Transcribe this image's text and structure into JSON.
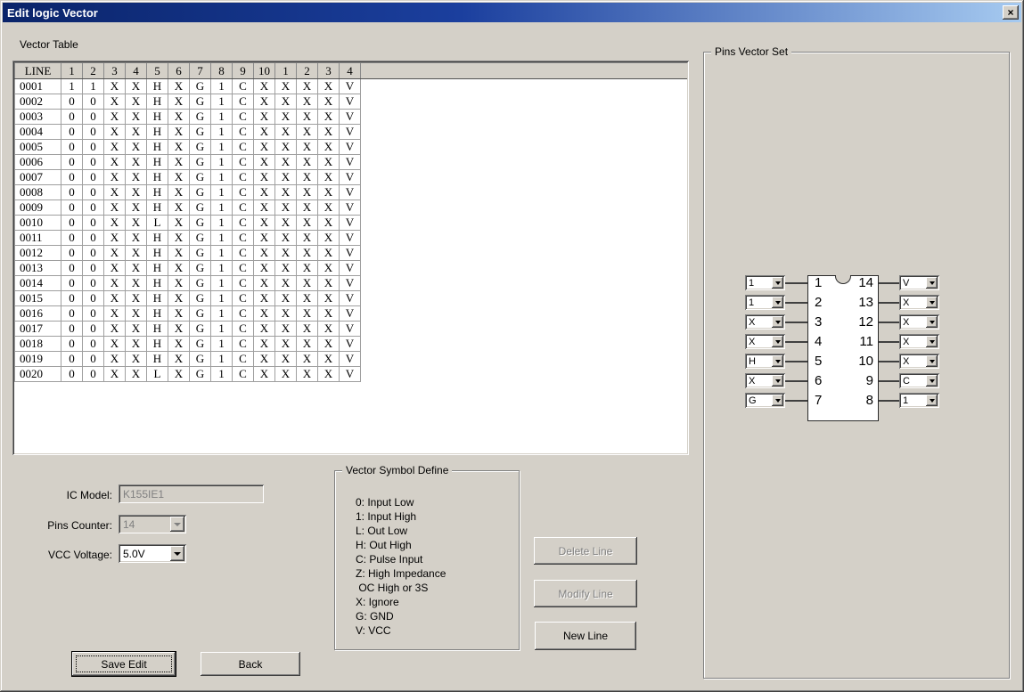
{
  "window": {
    "title": "Edit logic Vector",
    "close_glyph": "×"
  },
  "vector_table": {
    "section_label": "Vector Table",
    "headers": [
      "LINE",
      "1",
      "2",
      "3",
      "4",
      "5",
      "6",
      "7",
      "8",
      "9",
      "10",
      "1",
      "2",
      "3",
      "4"
    ],
    "rows": [
      {
        "line": "0001",
        "values": [
          "1",
          "1",
          "X",
          "X",
          "H",
          "X",
          "G",
          "1",
          "C",
          "X",
          "X",
          "X",
          "X",
          "V"
        ]
      },
      {
        "line": "0002",
        "values": [
          "0",
          "0",
          "X",
          "X",
          "H",
          "X",
          "G",
          "1",
          "C",
          "X",
          "X",
          "X",
          "X",
          "V"
        ]
      },
      {
        "line": "0003",
        "values": [
          "0",
          "0",
          "X",
          "X",
          "H",
          "X",
          "G",
          "1",
          "C",
          "X",
          "X",
          "X",
          "X",
          "V"
        ]
      },
      {
        "line": "0004",
        "values": [
          "0",
          "0",
          "X",
          "X",
          "H",
          "X",
          "G",
          "1",
          "C",
          "X",
          "X",
          "X",
          "X",
          "V"
        ]
      },
      {
        "line": "0005",
        "values": [
          "0",
          "0",
          "X",
          "X",
          "H",
          "X",
          "G",
          "1",
          "C",
          "X",
          "X",
          "X",
          "X",
          "V"
        ]
      },
      {
        "line": "0006",
        "values": [
          "0",
          "0",
          "X",
          "X",
          "H",
          "X",
          "G",
          "1",
          "C",
          "X",
          "X",
          "X",
          "X",
          "V"
        ]
      },
      {
        "line": "0007",
        "values": [
          "0",
          "0",
          "X",
          "X",
          "H",
          "X",
          "G",
          "1",
          "C",
          "X",
          "X",
          "X",
          "X",
          "V"
        ]
      },
      {
        "line": "0008",
        "values": [
          "0",
          "0",
          "X",
          "X",
          "H",
          "X",
          "G",
          "1",
          "C",
          "X",
          "X",
          "X",
          "X",
          "V"
        ]
      },
      {
        "line": "0009",
        "values": [
          "0",
          "0",
          "X",
          "X",
          "H",
          "X",
          "G",
          "1",
          "C",
          "X",
          "X",
          "X",
          "X",
          "V"
        ]
      },
      {
        "line": "0010",
        "values": [
          "0",
          "0",
          "X",
          "X",
          "L",
          "X",
          "G",
          "1",
          "C",
          "X",
          "X",
          "X",
          "X",
          "V"
        ]
      },
      {
        "line": "0011",
        "values": [
          "0",
          "0",
          "X",
          "X",
          "H",
          "X",
          "G",
          "1",
          "C",
          "X",
          "X",
          "X",
          "X",
          "V"
        ]
      },
      {
        "line": "0012",
        "values": [
          "0",
          "0",
          "X",
          "X",
          "H",
          "X",
          "G",
          "1",
          "C",
          "X",
          "X",
          "X",
          "X",
          "V"
        ]
      },
      {
        "line": "0013",
        "values": [
          "0",
          "0",
          "X",
          "X",
          "H",
          "X",
          "G",
          "1",
          "C",
          "X",
          "X",
          "X",
          "X",
          "V"
        ]
      },
      {
        "line": "0014",
        "values": [
          "0",
          "0",
          "X",
          "X",
          "H",
          "X",
          "G",
          "1",
          "C",
          "X",
          "X",
          "X",
          "X",
          "V"
        ]
      },
      {
        "line": "0015",
        "values": [
          "0",
          "0",
          "X",
          "X",
          "H",
          "X",
          "G",
          "1",
          "C",
          "X",
          "X",
          "X",
          "X",
          "V"
        ]
      },
      {
        "line": "0016",
        "values": [
          "0",
          "0",
          "X",
          "X",
          "H",
          "X",
          "G",
          "1",
          "C",
          "X",
          "X",
          "X",
          "X",
          "V"
        ]
      },
      {
        "line": "0017",
        "values": [
          "0",
          "0",
          "X",
          "X",
          "H",
          "X",
          "G",
          "1",
          "C",
          "X",
          "X",
          "X",
          "X",
          "V"
        ]
      },
      {
        "line": "0018",
        "values": [
          "0",
          "0",
          "X",
          "X",
          "H",
          "X",
          "G",
          "1",
          "C",
          "X",
          "X",
          "X",
          "X",
          "V"
        ]
      },
      {
        "line": "0019",
        "values": [
          "0",
          "0",
          "X",
          "X",
          "H",
          "X",
          "G",
          "1",
          "C",
          "X",
          "X",
          "X",
          "X",
          "V"
        ]
      },
      {
        "line": "0020",
        "values": [
          "0",
          "0",
          "X",
          "X",
          "L",
          "X",
          "G",
          "1",
          "C",
          "X",
          "X",
          "X",
          "X",
          "V"
        ]
      }
    ]
  },
  "device": {
    "ic_model_label": "IC Model:",
    "ic_model_value": "K155IE1",
    "pins_counter_label": "Pins Counter:",
    "pins_counter_value": "14",
    "vcc_voltage_label": "VCC Voltage:",
    "vcc_voltage_value": "5.0V"
  },
  "symbol_define": {
    "title": "Vector Symbol Define",
    "lines": [
      "0: Input Low",
      "1: Input High",
      "L: Out Low",
      "H: Out High",
      "C: Pulse Input",
      "Z: High Impedance",
      " OC High or 3S",
      "X: Ignore",
      "G: GND",
      "V: VCC"
    ]
  },
  "actions": {
    "delete_line": {
      "label": "Delete Line",
      "enabled": false
    },
    "modify_line": {
      "label": "Modify Line",
      "enabled": false
    },
    "new_line": {
      "label": "New Line",
      "enabled": true
    },
    "save_edit": {
      "label": "Save Edit"
    },
    "back": {
      "label": "Back"
    }
  },
  "pins_vector_set": {
    "title": "Pins Vector Set",
    "left_pins": [
      {
        "pin": "1",
        "value": "1"
      },
      {
        "pin": "2",
        "value": "1"
      },
      {
        "pin": "3",
        "value": "X"
      },
      {
        "pin": "4",
        "value": "X"
      },
      {
        "pin": "5",
        "value": "H"
      },
      {
        "pin": "6",
        "value": "X"
      },
      {
        "pin": "7",
        "value": "G"
      }
    ],
    "right_pins": [
      {
        "pin": "14",
        "value": "V"
      },
      {
        "pin": "13",
        "value": "X"
      },
      {
        "pin": "12",
        "value": "X"
      },
      {
        "pin": "11",
        "value": "X"
      },
      {
        "pin": "10",
        "value": "X"
      },
      {
        "pin": "9",
        "value": "C"
      },
      {
        "pin": "8",
        "value": "1"
      }
    ]
  },
  "colors": {
    "titlebar_left": "#0A246A",
    "titlebar_right": "#A6CAF0",
    "face": "#D4D0C8",
    "disabled_text": "#808080"
  }
}
